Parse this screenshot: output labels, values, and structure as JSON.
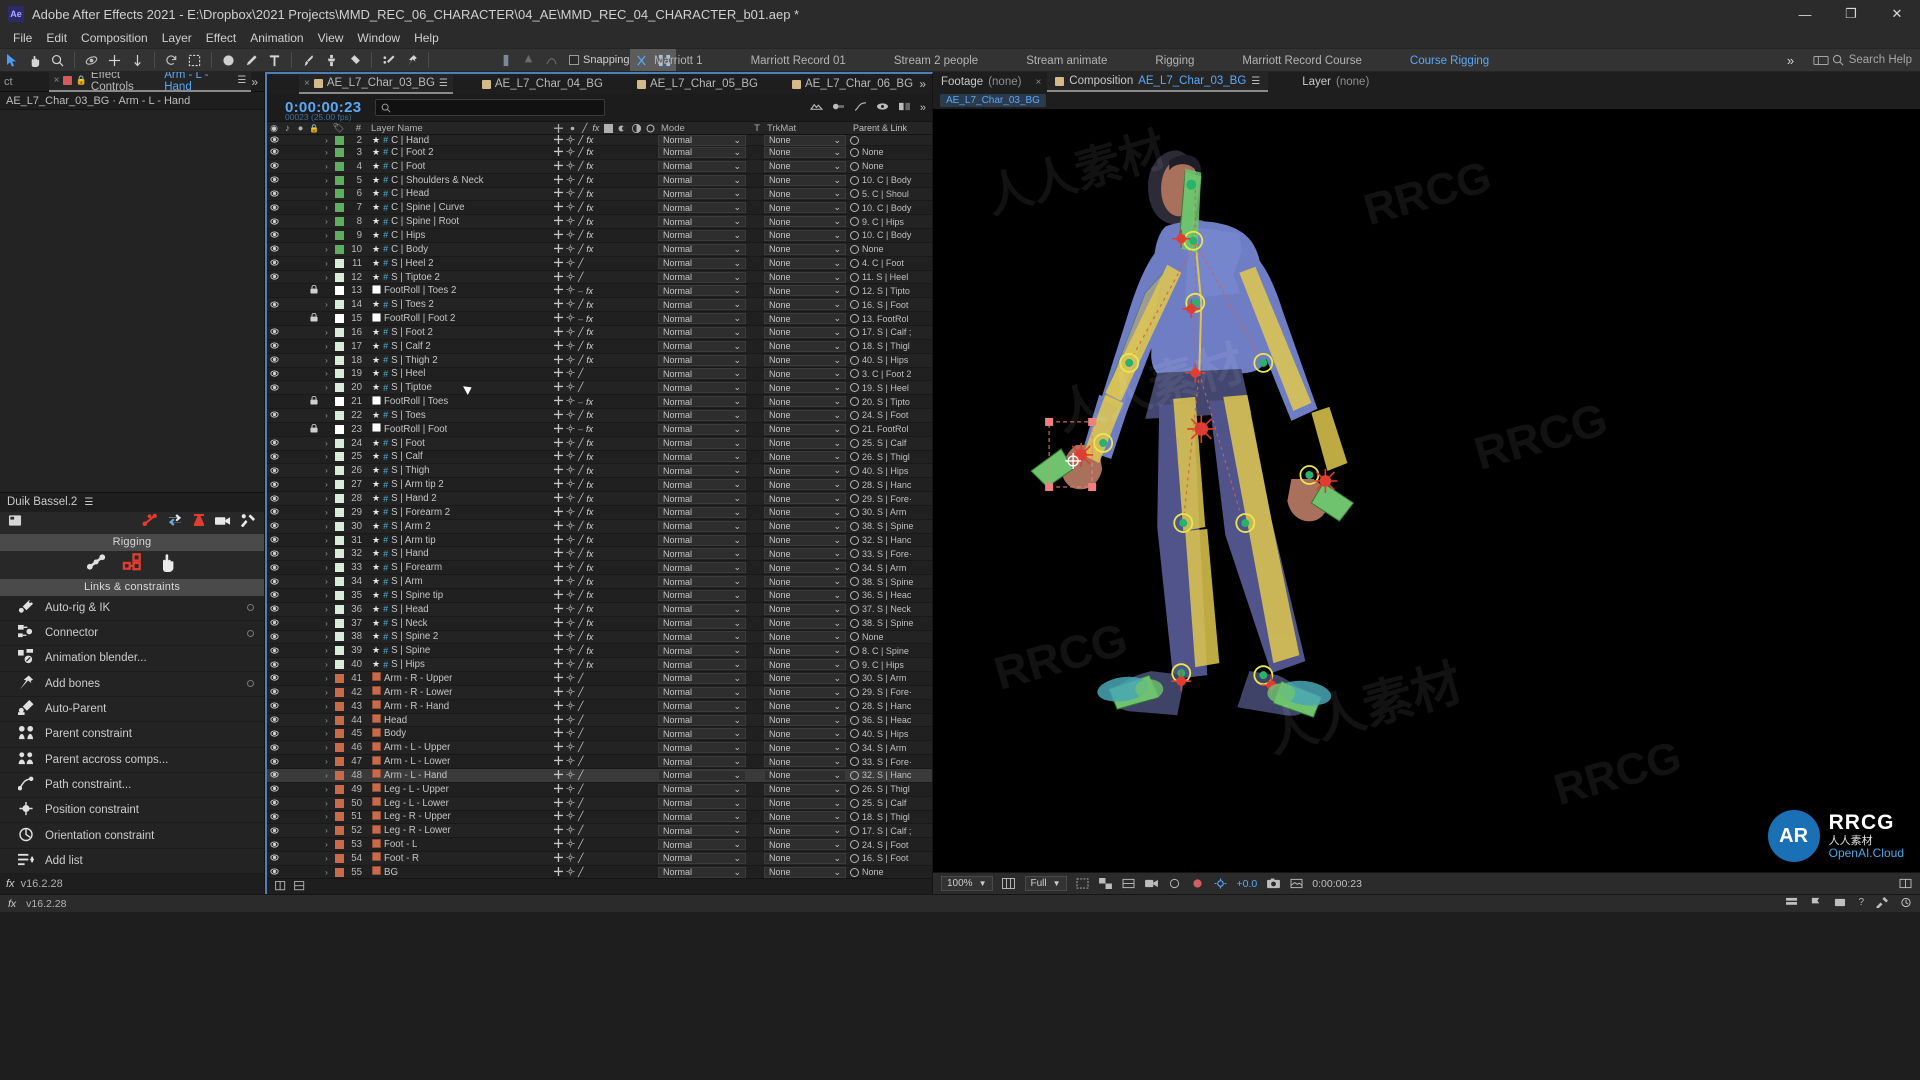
{
  "window": {
    "title": "Adobe After Effects 2021 - E:\\Dropbox\\2021 Projects\\MMD_REC_06_CHARACTER\\04_AE\\MMD_REC_04_CHARACTER_b01.aep *",
    "app_badge": "Ae",
    "minimize": "—",
    "maximize": "❐",
    "close": "✕"
  },
  "menu": {
    "items": [
      "File",
      "Edit",
      "Composition",
      "Layer",
      "Effect",
      "Animation",
      "View",
      "Window",
      "Help"
    ]
  },
  "toolbar": {
    "snapping_label": "Snapping",
    "search_help": "Search Help",
    "workspace_tabs": [
      {
        "label": "Marriott 1",
        "active": false
      },
      {
        "label": "Marriott Record 01",
        "active": false
      },
      {
        "label": "Stream 2 people",
        "active": false
      },
      {
        "label": "Stream animate",
        "active": false
      },
      {
        "label": "Rigging",
        "active": false
      },
      {
        "label": "Marriott Record Course",
        "active": false
      },
      {
        "label": "Course Rigging",
        "active": true
      }
    ]
  },
  "effect_controls": {
    "project_tab": "ct",
    "tab_label": "Effect Controls",
    "tab_target": "Arm - L - Hand",
    "subtitle": "AE_L7_Char_03_BG · Arm - L - Hand"
  },
  "duik": {
    "title": "Duik Bassel.2",
    "section_rigging": "Rigging",
    "section_links": "Links & constraints",
    "items": [
      {
        "label": "Auto-rig & IK",
        "icon": "autorig-icon",
        "gear": true
      },
      {
        "label": "Connector",
        "icon": "connector-icon",
        "gear": true
      },
      {
        "label": "Animation blender...",
        "icon": "animation-blender-icon",
        "gear": false
      },
      {
        "label": "Add bones",
        "icon": "add-bones-icon",
        "gear": true
      },
      {
        "label": "Auto-Parent",
        "icon": "auto-parent-icon",
        "gear": false
      },
      {
        "label": "Parent constraint",
        "icon": "parent-constraint-icon",
        "gear": false
      },
      {
        "label": "Parent accross comps...",
        "icon": "parent-across-comps-icon",
        "gear": false
      },
      {
        "label": "Path constraint...",
        "icon": "path-constraint-icon",
        "gear": false
      },
      {
        "label": "Position constraint",
        "icon": "position-constraint-icon",
        "gear": false
      },
      {
        "label": "Orientation constraint",
        "icon": "orientation-constraint-icon",
        "gear": false
      },
      {
        "label": "Add list",
        "icon": "add-list-icon",
        "gear": false
      }
    ],
    "version": "v16.2.28"
  },
  "timeline": {
    "tabs": [
      {
        "label": "AE_L7_Char_03_BG",
        "active": true
      },
      {
        "label": "AE_L7_Char_04_BG",
        "active": false
      },
      {
        "label": "AE_L7_Char_05_BG",
        "active": false
      },
      {
        "label": "AE_L7_Char_06_BG",
        "active": false
      }
    ],
    "timecode": "0:00:00:23",
    "timecode_sub": "00023 (25.00 fps)",
    "search_placeholder": "",
    "columns": {
      "layer_name": "Layer Name",
      "mode": "Mode",
      "t": "T",
      "trkmat": "TrkMat",
      "parent": "Parent & Link",
      "hash": "#"
    },
    "rows": [
      {
        "num": "2",
        "name": "C | Hand",
        "color": "#5fae5f",
        "star": true,
        "fx": true,
        "mode": "Normal",
        "trkmat": "None",
        "parent": "",
        "partial": true,
        "lock": false,
        "solid": false
      },
      {
        "num": "3",
        "name": "C | Foot 2",
        "color": "#5fae5f",
        "star": true,
        "fx": true,
        "mode": "Normal",
        "trkmat": "None",
        "parent": "None",
        "lock": false,
        "solid": false
      },
      {
        "num": "4",
        "name": "C | Foot",
        "color": "#5fae5f",
        "star": true,
        "fx": true,
        "mode": "Normal",
        "trkmat": "None",
        "parent": "None",
        "lock": false,
        "solid": false
      },
      {
        "num": "5",
        "name": "C | Shoulders & Neck",
        "color": "#5fae5f",
        "star": true,
        "fx": true,
        "mode": "Normal",
        "trkmat": "None",
        "parent": "10. C | Body",
        "lock": false,
        "solid": false
      },
      {
        "num": "6",
        "name": "C | Head",
        "color": "#5fae5f",
        "star": true,
        "fx": true,
        "mode": "Normal",
        "trkmat": "None",
        "parent": "5. C | Shoul",
        "lock": false,
        "solid": false
      },
      {
        "num": "7",
        "name": "C | Spine | Curve",
        "color": "#5fae5f",
        "star": true,
        "fx": true,
        "mode": "Normal",
        "trkmat": "None",
        "parent": "10. C | Body",
        "lock": false,
        "solid": false
      },
      {
        "num": "8",
        "name": "C | Spine | Root",
        "color": "#5fae5f",
        "star": true,
        "fx": true,
        "mode": "Normal",
        "trkmat": "None",
        "parent": "9. C | Hips",
        "lock": false,
        "solid": false
      },
      {
        "num": "9",
        "name": "C | Hips",
        "color": "#5fae5f",
        "star": true,
        "fx": true,
        "mode": "Normal",
        "trkmat": "None",
        "parent": "10. C | Body",
        "lock": false,
        "solid": false
      },
      {
        "num": "10",
        "name": "C | Body",
        "color": "#5fae5f",
        "star": true,
        "fx": true,
        "mode": "Normal",
        "trkmat": "None",
        "parent": "None",
        "lock": false,
        "solid": false
      },
      {
        "num": "11",
        "name": "S | Heel 2",
        "color": "#d9ecd9",
        "star": true,
        "fx": false,
        "mode": "Normal",
        "trkmat": "None",
        "parent": "4. C | Foot",
        "lock": false,
        "solid": false
      },
      {
        "num": "12",
        "name": "S | Tiptoe 2",
        "color": "#d9ecd9",
        "star": true,
        "fx": false,
        "mode": "Normal",
        "trkmat": "None",
        "parent": "11. S | Heel",
        "lock": false,
        "solid": false
      },
      {
        "num": "13",
        "name": "FootRoll | Toes 2",
        "color": "#ffffff",
        "star": false,
        "fx": true,
        "mode": "Normal",
        "trkmat": "None",
        "parent": "12. S | Tipto",
        "lock": true,
        "solid": true
      },
      {
        "num": "14",
        "name": "S | Toes 2",
        "color": "#d9ecd9",
        "star": true,
        "fx": true,
        "mode": "Normal",
        "trkmat": "None",
        "parent": "16. S | Foot",
        "lock": false,
        "solid": false
      },
      {
        "num": "15",
        "name": "FootRoll | Foot 2",
        "color": "#ffffff",
        "star": false,
        "fx": true,
        "mode": "Normal",
        "trkmat": "None",
        "parent": "13. FootRol",
        "lock": true,
        "solid": true
      },
      {
        "num": "16",
        "name": "S | Foot 2",
        "color": "#d9ecd9",
        "star": true,
        "fx": true,
        "mode": "Normal",
        "trkmat": "None",
        "parent": "17. S | Calf ;",
        "lock": false,
        "solid": false
      },
      {
        "num": "17",
        "name": "S | Calf 2",
        "color": "#d9ecd9",
        "star": true,
        "fx": true,
        "mode": "Normal",
        "trkmat": "None",
        "parent": "18. S | Thigl",
        "lock": false,
        "solid": false
      },
      {
        "num": "18",
        "name": "S | Thigh 2",
        "color": "#d9ecd9",
        "star": true,
        "fx": true,
        "mode": "Normal",
        "trkmat": "None",
        "parent": "40. S | Hips",
        "lock": false,
        "solid": false
      },
      {
        "num": "19",
        "name": "S | Heel",
        "color": "#d9ecd9",
        "star": true,
        "fx": false,
        "mode": "Normal",
        "trkmat": "None",
        "parent": "3. C | Foot 2",
        "lock": false,
        "solid": false
      },
      {
        "num": "20",
        "name": "S | Tiptoe",
        "color": "#d9ecd9",
        "star": true,
        "fx": false,
        "mode": "Normal",
        "trkmat": "None",
        "parent": "19. S | Heel",
        "lock": false,
        "solid": false
      },
      {
        "num": "21",
        "name": "FootRoll | Toes",
        "color": "#ffffff",
        "star": false,
        "fx": true,
        "mode": "Normal",
        "trkmat": "None",
        "parent": "20. S | Tipto",
        "lock": true,
        "solid": true
      },
      {
        "num": "22",
        "name": "S | Toes",
        "color": "#d9ecd9",
        "star": true,
        "fx": true,
        "mode": "Normal",
        "trkmat": "None",
        "parent": "24. S | Foot",
        "lock": false,
        "solid": false
      },
      {
        "num": "23",
        "name": "FootRoll | Foot",
        "color": "#ffffff",
        "star": false,
        "fx": true,
        "mode": "Normal",
        "trkmat": "None",
        "parent": "21. FootRol",
        "lock": true,
        "solid": true
      },
      {
        "num": "24",
        "name": "S | Foot",
        "color": "#d9ecd9",
        "star": true,
        "fx": true,
        "mode": "Normal",
        "trkmat": "None",
        "parent": "25. S | Calf",
        "lock": false,
        "solid": false
      },
      {
        "num": "25",
        "name": "S | Calf",
        "color": "#d9ecd9",
        "star": true,
        "fx": true,
        "mode": "Normal",
        "trkmat": "None",
        "parent": "26. S | Thigl",
        "lock": false,
        "solid": false
      },
      {
        "num": "26",
        "name": "S | Thigh",
        "color": "#d9ecd9",
        "star": true,
        "fx": true,
        "mode": "Normal",
        "trkmat": "None",
        "parent": "40. S | Hips",
        "lock": false,
        "solid": false
      },
      {
        "num": "27",
        "name": "S | Arm tip 2",
        "color": "#d9ecd9",
        "star": true,
        "fx": true,
        "mode": "Normal",
        "trkmat": "None",
        "parent": "28. S | Hanc",
        "lock": false,
        "solid": false
      },
      {
        "num": "28",
        "name": "S | Hand 2",
        "color": "#d9ecd9",
        "star": true,
        "fx": true,
        "mode": "Normal",
        "trkmat": "None",
        "parent": "29. S | Fore·",
        "lock": false,
        "solid": false
      },
      {
        "num": "29",
        "name": "S | Forearm 2",
        "color": "#d9ecd9",
        "star": true,
        "fx": true,
        "mode": "Normal",
        "trkmat": "None",
        "parent": "30. S | Arm",
        "lock": false,
        "solid": false
      },
      {
        "num": "30",
        "name": "S | Arm 2",
        "color": "#d9ecd9",
        "star": true,
        "fx": true,
        "mode": "Normal",
        "trkmat": "None",
        "parent": "38. S | Spine",
        "lock": false,
        "solid": false
      },
      {
        "num": "31",
        "name": "S | Arm tip",
        "color": "#d9ecd9",
        "star": true,
        "fx": true,
        "mode": "Normal",
        "trkmat": "None",
        "parent": "32. S | Hanc",
        "lock": false,
        "solid": false
      },
      {
        "num": "32",
        "name": "S | Hand",
        "color": "#d9ecd9",
        "star": true,
        "fx": true,
        "mode": "Normal",
        "trkmat": "None",
        "parent": "33. S | Fore·",
        "lock": false,
        "solid": false
      },
      {
        "num": "33",
        "name": "S | Forearm",
        "color": "#d9ecd9",
        "star": true,
        "fx": true,
        "mode": "Normal",
        "trkmat": "None",
        "parent": "34. S | Arm",
        "lock": false,
        "solid": false
      },
      {
        "num": "34",
        "name": "S | Arm",
        "color": "#d9ecd9",
        "star": true,
        "fx": true,
        "mode": "Normal",
        "trkmat": "None",
        "parent": "38. S | Spine",
        "lock": false,
        "solid": false
      },
      {
        "num": "35",
        "name": "S | Spine tip",
        "color": "#d9ecd9",
        "star": true,
        "fx": true,
        "mode": "Normal",
        "trkmat": "None",
        "parent": "36. S | Heac",
        "lock": false,
        "solid": false
      },
      {
        "num": "36",
        "name": "S | Head",
        "color": "#d9ecd9",
        "star": true,
        "fx": true,
        "mode": "Normal",
        "trkmat": "None",
        "parent": "37. S | Neck",
        "lock": false,
        "solid": false
      },
      {
        "num": "37",
        "name": "S | Neck",
        "color": "#d9ecd9",
        "star": true,
        "fx": true,
        "mode": "Normal",
        "trkmat": "None",
        "parent": "38. S | Spine",
        "lock": false,
        "solid": false
      },
      {
        "num": "38",
        "name": "S | Spine 2",
        "color": "#d9ecd9",
        "star": true,
        "fx": true,
        "mode": "Normal",
        "trkmat": "None",
        "parent": "None",
        "lock": false,
        "solid": false
      },
      {
        "num": "39",
        "name": "S | Spine",
        "color": "#d9ecd9",
        "star": true,
        "fx": true,
        "mode": "Normal",
        "trkmat": "None",
        "parent": "8. C | Spine",
        "lock": false,
        "solid": false
      },
      {
        "num": "40",
        "name": "S | Hips",
        "color": "#d9ecd9",
        "star": true,
        "fx": true,
        "mode": "Normal",
        "trkmat": "None",
        "parent": "9. C | Hips",
        "lock": false,
        "solid": false
      },
      {
        "num": "41",
        "name": "Arm - R - Upper",
        "color": "#c96a4a",
        "star": false,
        "fx": false,
        "mode": "Normal",
        "trkmat": "None",
        "parent": "30. S | Arm",
        "lock": false,
        "solid": false,
        "img": true
      },
      {
        "num": "42",
        "name": "Arm - R - Lower",
        "color": "#c96a4a",
        "star": false,
        "fx": false,
        "mode": "Normal",
        "trkmat": "None",
        "parent": "29. S | Fore·",
        "lock": false,
        "solid": false,
        "img": true
      },
      {
        "num": "43",
        "name": "Arm - R - Hand",
        "color": "#c96a4a",
        "star": false,
        "fx": false,
        "mode": "Normal",
        "trkmat": "None",
        "parent": "28. S | Hanc",
        "lock": false,
        "solid": false,
        "img": true
      },
      {
        "num": "44",
        "name": "Head",
        "color": "#c96a4a",
        "star": false,
        "fx": false,
        "mode": "Normal",
        "trkmat": "None",
        "parent": "36. S | Heac",
        "lock": false,
        "solid": false,
        "img": true
      },
      {
        "num": "45",
        "name": "Body",
        "color": "#c96a4a",
        "star": false,
        "fx": false,
        "mode": "Normal",
        "trkmat": "None",
        "parent": "40. S | Hips",
        "lock": false,
        "solid": false,
        "img": true
      },
      {
        "num": "46",
        "name": "Arm - L - Upper",
        "color": "#c96a4a",
        "star": false,
        "fx": false,
        "mode": "Normal",
        "trkmat": "None",
        "parent": "34. S | Arm",
        "lock": false,
        "solid": false,
        "img": true
      },
      {
        "num": "47",
        "name": "Arm - L - Lower",
        "color": "#c96a4a",
        "star": false,
        "fx": false,
        "mode": "Normal",
        "trkmat": "None",
        "parent": "33. S | Fore·",
        "lock": false,
        "solid": false,
        "img": true
      },
      {
        "num": "48",
        "name": "Arm - L - Hand",
        "color": "#c96a4a",
        "star": false,
        "fx": false,
        "mode": "Normal",
        "trkmat": "None",
        "parent": "32. S | Hanc",
        "lock": false,
        "solid": false,
        "img": true,
        "selected": true
      },
      {
        "num": "49",
        "name": "Leg - L - Upper",
        "color": "#c96a4a",
        "star": false,
        "fx": false,
        "mode": "Normal",
        "trkmat": "None",
        "parent": "26. S | Thigl",
        "lock": false,
        "solid": false,
        "img": true
      },
      {
        "num": "50",
        "name": "Leg - L - Lower",
        "color": "#c96a4a",
        "star": false,
        "fx": false,
        "mode": "Normal",
        "trkmat": "None",
        "parent": "25. S | Calf",
        "lock": false,
        "solid": false,
        "img": true
      },
      {
        "num": "51",
        "name": "Leg - R - Upper",
        "color": "#c96a4a",
        "star": false,
        "fx": false,
        "mode": "Normal",
        "trkmat": "None",
        "parent": "18. S | Thigl",
        "lock": false,
        "solid": false,
        "img": true
      },
      {
        "num": "52",
        "name": "Leg - R - Lower",
        "color": "#c96a4a",
        "star": false,
        "fx": false,
        "mode": "Normal",
        "trkmat": "None",
        "parent": "17. S | Calf ;",
        "lock": false,
        "solid": false,
        "img": true
      },
      {
        "num": "53",
        "name": "Foot - L",
        "color": "#c96a4a",
        "star": false,
        "fx": false,
        "mode": "Normal",
        "trkmat": "None",
        "parent": "24. S | Foot",
        "lock": false,
        "solid": false,
        "img": true
      },
      {
        "num": "54",
        "name": "Foot - R",
        "color": "#c96a4a",
        "star": false,
        "fx": false,
        "mode": "Normal",
        "trkmat": "None",
        "parent": "16. S | Foot",
        "lock": false,
        "solid": false,
        "img": true
      },
      {
        "num": "55",
        "name": "BG",
        "color": "#c96a4a",
        "star": false,
        "fx": false,
        "mode": "Normal",
        "trkmat": "None",
        "parent": "None",
        "lock": false,
        "solid": false,
        "img": true
      }
    ]
  },
  "viewer": {
    "footage_label": "Footage",
    "footage_value": "(none)",
    "comp_label": "Composition",
    "comp_value": "AE_L7_Char_03_BG",
    "layer_label": "Layer",
    "layer_value": "(none)",
    "comp_chip": "AE_L7_Char_03_BG",
    "zoom": "100%",
    "resolution": "Full",
    "exposure": "+0.0",
    "timecode": "0:00:00:23",
    "watermark_brand": "RRCG",
    "watermark_cn": "人人素材",
    "watermark_cloud": "OpenAI.Cloud",
    "watermark_logo": "AR"
  },
  "status": {
    "version": "v16.2.28"
  },
  "colors": {
    "accent_blue": "#5aa9f8",
    "duik_red": "#e03c31",
    "layer_green": "#5fae5f",
    "layer_pale": "#d9ecd9",
    "layer_orange": "#c96a4a"
  }
}
